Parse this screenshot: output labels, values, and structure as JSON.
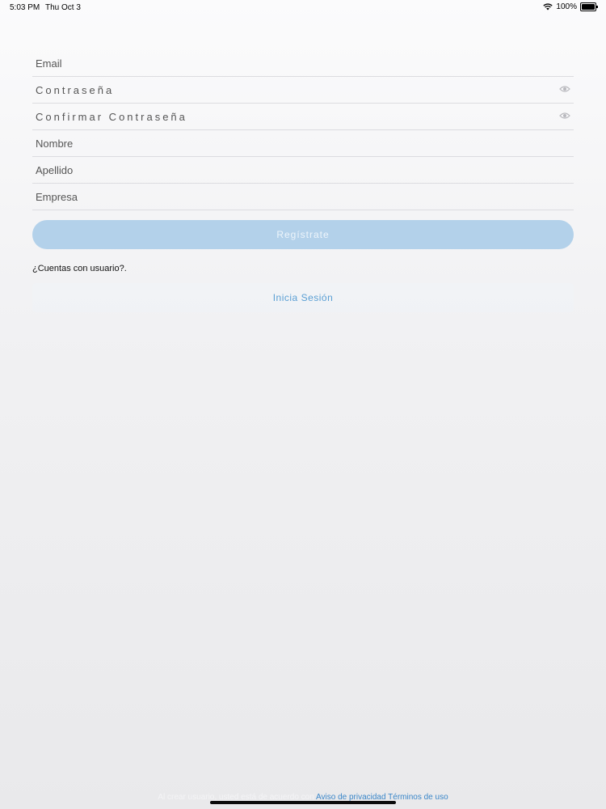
{
  "status_bar": {
    "time": "5:03 PM",
    "date": "Thu Oct 3",
    "battery": "100%"
  },
  "form": {
    "email": {
      "placeholder": "Email",
      "value": ""
    },
    "password": {
      "placeholder": "Contraseña",
      "value": ""
    },
    "confirm_password": {
      "placeholder": "Confirmar Contraseña",
      "value": ""
    },
    "first_name": {
      "placeholder": "Nombre",
      "value": ""
    },
    "last_name": {
      "placeholder": "Apellido",
      "value": ""
    },
    "company": {
      "placeholder": "Empresa",
      "value": ""
    }
  },
  "buttons": {
    "register": "Regístrate",
    "login": "Inicia Sesión"
  },
  "have_account_label": "¿Cuentas con usuario?.",
  "footer": {
    "prefix": "Al crear usuario, usted está de acuerdo con",
    "privacy_link": "Aviso de privacidad",
    "terms_link": "Términos de uso"
  },
  "colors": {
    "accent": "#5a9fd4",
    "register_button_bg": "#b3d1ea",
    "link": "#3a86c8"
  },
  "icons": {
    "wifi": "wifi-icon",
    "battery": "battery-icon",
    "show_password": "eye-icon"
  }
}
